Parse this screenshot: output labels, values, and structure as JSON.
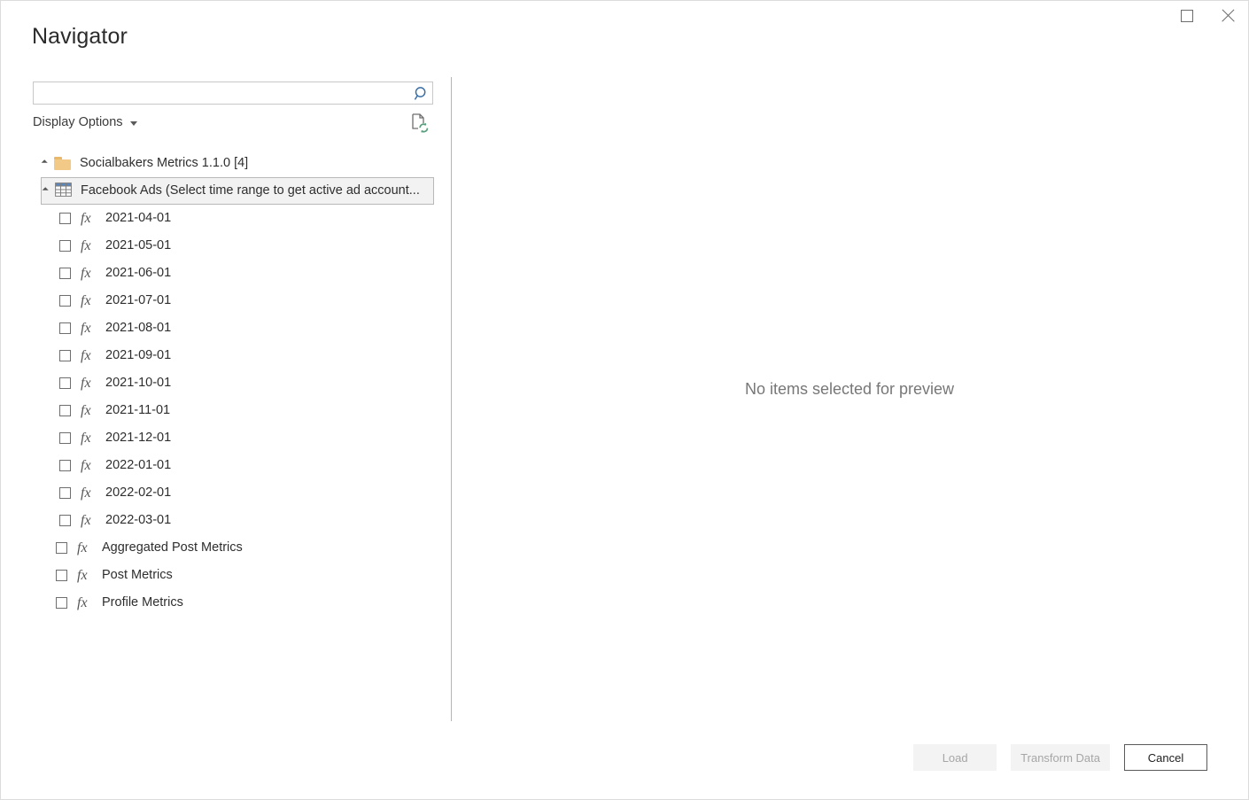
{
  "window": {
    "title": "Navigator",
    "maximize_icon": "maximize-icon",
    "close_icon": "close-icon"
  },
  "search": {
    "value": "",
    "placeholder": "",
    "icon": "search-icon"
  },
  "options_bar": {
    "display_options_label": "Display Options",
    "caret_icon": "chevron-down-icon",
    "refresh_preview_icon": "refresh-document-icon"
  },
  "tree": [
    {
      "level": 0,
      "kind": "folder",
      "label": "Socialbakers Metrics 1.1.0 [4]",
      "expanded": true,
      "selected": false,
      "icon": "folder-icon"
    },
    {
      "level": 1,
      "kind": "table",
      "label": "Facebook Ads (Select time range to get active ad account...",
      "expanded": true,
      "selected": true,
      "icon": "table-grid-icon"
    },
    {
      "level": 2,
      "kind": "function",
      "label": "2021-04-01",
      "checked": false,
      "icon": "fx-icon"
    },
    {
      "level": 2,
      "kind": "function",
      "label": "2021-05-01",
      "checked": false,
      "icon": "fx-icon"
    },
    {
      "level": 2,
      "kind": "function",
      "label": "2021-06-01",
      "checked": false,
      "icon": "fx-icon"
    },
    {
      "level": 2,
      "kind": "function",
      "label": "2021-07-01",
      "checked": false,
      "icon": "fx-icon"
    },
    {
      "level": 2,
      "kind": "function",
      "label": "2021-08-01",
      "checked": false,
      "icon": "fx-icon"
    },
    {
      "level": 2,
      "kind": "function",
      "label": "2021-09-01",
      "checked": false,
      "icon": "fx-icon"
    },
    {
      "level": 2,
      "kind": "function",
      "label": "2021-10-01",
      "checked": false,
      "icon": "fx-icon"
    },
    {
      "level": 2,
      "kind": "function",
      "label": "2021-11-01",
      "checked": false,
      "icon": "fx-icon"
    },
    {
      "level": 2,
      "kind": "function",
      "label": "2021-12-01",
      "checked": false,
      "icon": "fx-icon"
    },
    {
      "level": 2,
      "kind": "function",
      "label": "2022-01-01",
      "checked": false,
      "icon": "fx-icon"
    },
    {
      "level": 2,
      "kind": "function",
      "label": "2022-02-01",
      "checked": false,
      "icon": "fx-icon"
    },
    {
      "level": 2,
      "kind": "function",
      "label": "2022-03-01",
      "checked": false,
      "icon": "fx-icon"
    },
    {
      "level": 1,
      "kind": "function",
      "label": "Aggregated Post Metrics",
      "checked": false,
      "icon": "fx-icon"
    },
    {
      "level": 1,
      "kind": "function",
      "label": "Post Metrics",
      "checked": false,
      "icon": "fx-icon"
    },
    {
      "level": 1,
      "kind": "function",
      "label": "Profile Metrics",
      "checked": false,
      "icon": "fx-icon"
    }
  ],
  "preview": {
    "empty_text": "No items selected for preview"
  },
  "footer": {
    "load_label": "Load",
    "transform_label": "Transform Data",
    "cancel_label": "Cancel",
    "load_enabled": false,
    "transform_enabled": false,
    "cancel_enabled": true
  },
  "colors": {
    "accent_blue": "#3b6ea5",
    "folder": "#f2c987",
    "selection_bg": "#f2f2f2",
    "selection_border": "#b8b8b8",
    "refresh_green": "#5a9e7e",
    "text": "#2e2e2e",
    "muted_text": "#777777"
  }
}
